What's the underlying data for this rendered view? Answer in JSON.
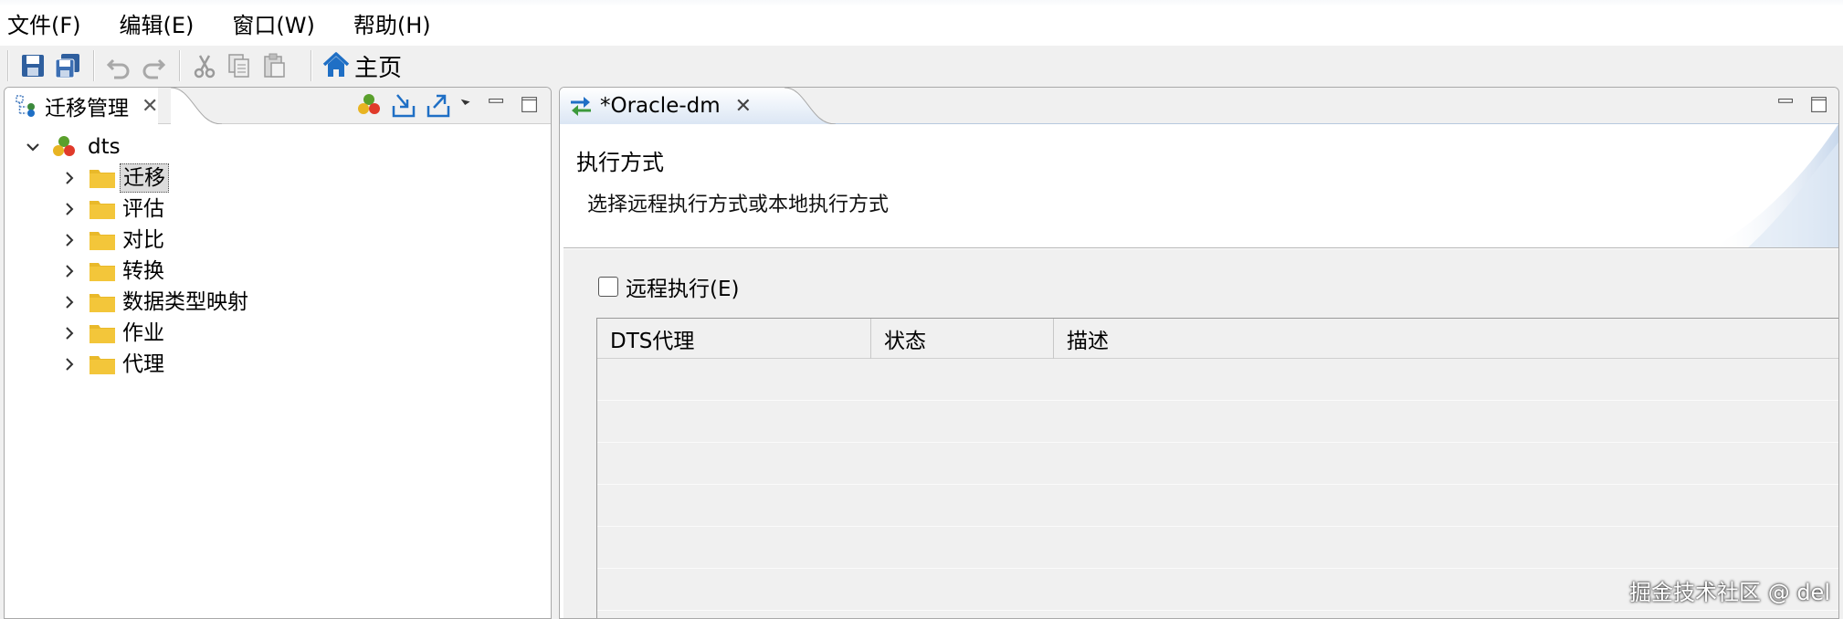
{
  "menubar": {
    "items": [
      {
        "label": "文件(F)"
      },
      {
        "label": "编辑(E)"
      },
      {
        "label": "窗口(W)"
      },
      {
        "label": "帮助(H)"
      }
    ]
  },
  "toolbar": {
    "buttons": [
      "save-icon",
      "save-all-icon",
      "undo-icon",
      "redo-icon",
      "cut-icon",
      "copy-icon",
      "paste-icon"
    ],
    "home_label": "主页"
  },
  "left_view": {
    "tab_label": "迁移管理",
    "tree": {
      "root": "dts",
      "children": [
        {
          "label": "迁移",
          "selected": true
        },
        {
          "label": "评估"
        },
        {
          "label": "对比"
        },
        {
          "label": "转换"
        },
        {
          "label": "数据类型映射"
        },
        {
          "label": "作业"
        },
        {
          "label": "代理"
        }
      ]
    }
  },
  "editor": {
    "tab_label": "*Oracle-dm",
    "wizard": {
      "title": "执行方式",
      "description": "选择远程执行方式或本地执行方式",
      "remote_checkbox_label": "远程执行(E)",
      "remote_checked": false,
      "table_headers": [
        "DTS代理",
        "状态",
        "描述"
      ]
    }
  },
  "watermark": "掘金技术社区 @ del",
  "colors": {
    "accent": "#1f6fc5",
    "folder": "#e9b92a",
    "tab_active": "#dbe6f4"
  }
}
